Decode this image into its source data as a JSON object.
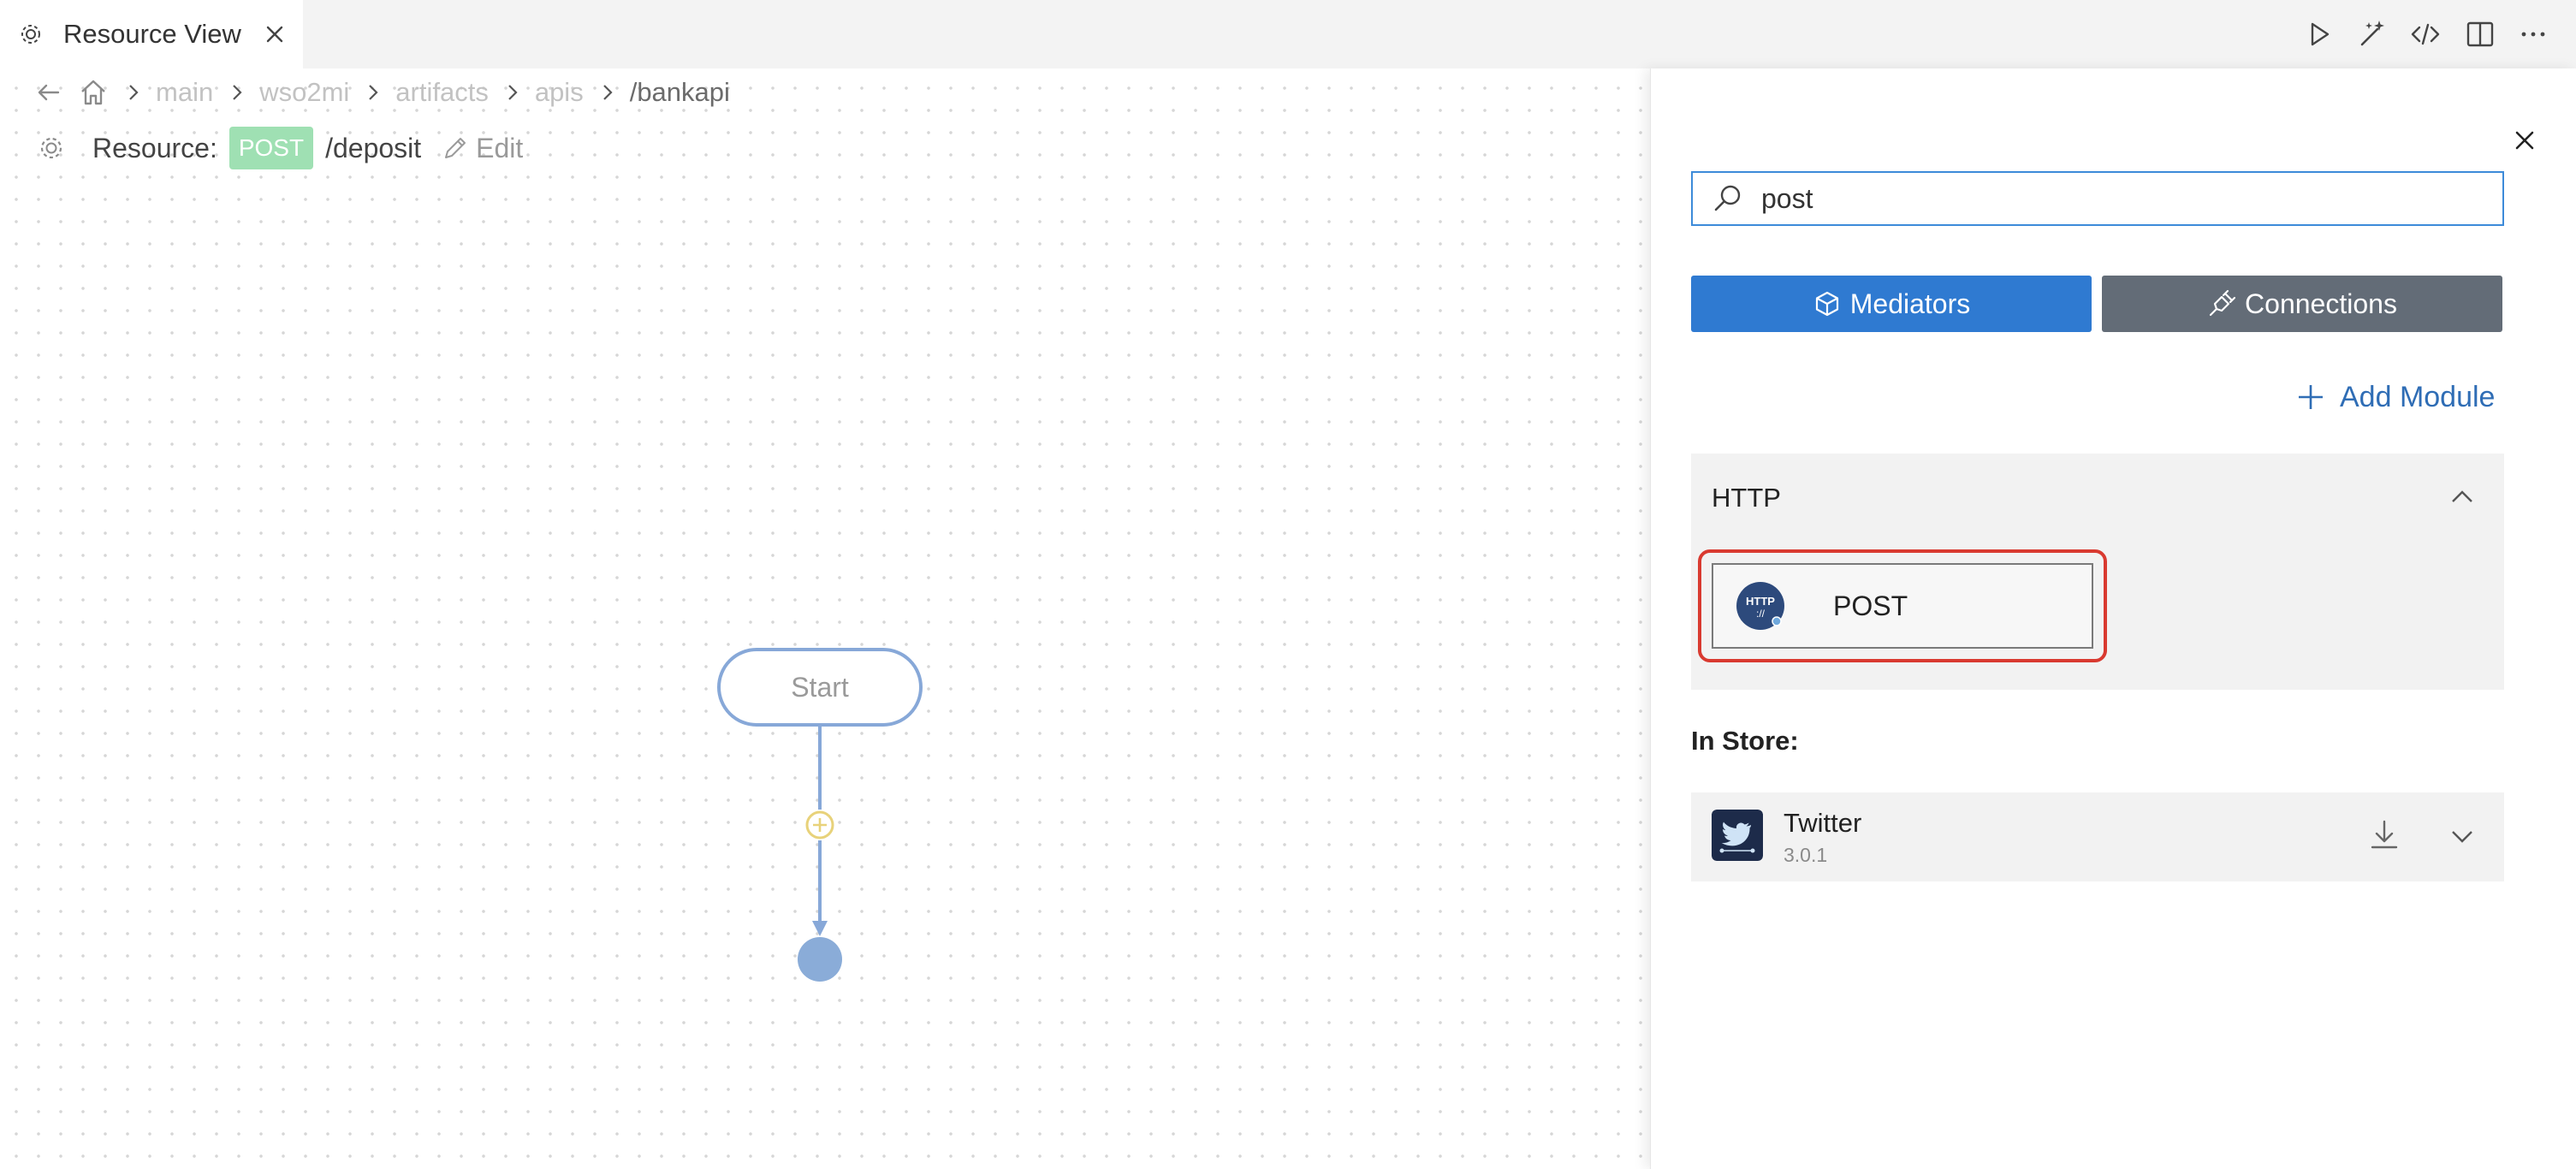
{
  "tab": {
    "title": "Resource View",
    "icon": "gear-icon",
    "close_icon": "close-icon"
  },
  "toolbar": {
    "icons": [
      "run-icon",
      "magic-wand-icon",
      "code-icon",
      "split-editor-icon",
      "more-icon"
    ]
  },
  "breadcrumb": {
    "items": [
      "main",
      "wso2mi",
      "artifacts",
      "apis",
      "/bankapi"
    ]
  },
  "resource": {
    "label": "Resource:",
    "method": "POST",
    "path": "/deposit",
    "edit_label": "Edit"
  },
  "diagram": {
    "start_label": "Start"
  },
  "panel": {
    "search": {
      "value": "post",
      "placeholder": "Search"
    },
    "mediators_label": "Mediators",
    "connections_label": "Connections",
    "add_module_label": "Add Module",
    "section": {
      "title": "HTTP",
      "items": [
        {
          "label": "POST",
          "icon": "http-icon"
        }
      ]
    },
    "in_store_label": "In Store:",
    "store_items": [
      {
        "name": "Twitter",
        "version": "3.0.1",
        "icon": "twitter-icon"
      }
    ]
  },
  "colors": {
    "accent": "#2f7ad1",
    "connections": "#636c77",
    "post_badge": "#9fe0b3",
    "highlight": "#d93a30",
    "flow": "#87a8d8"
  }
}
